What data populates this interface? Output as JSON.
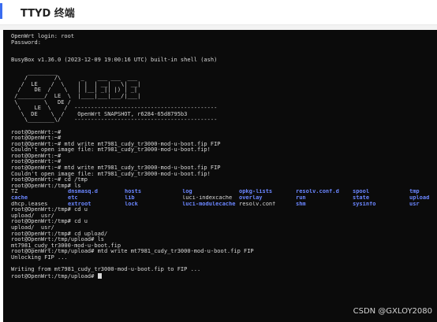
{
  "header": {
    "title": "TTYD 终端",
    "accent_color": "#3a6cf0"
  },
  "terminal": {
    "intro_lines": [
      "OpenWrt login: root",
      "Password:",
      "",
      "",
      "BusyBox v1.36.0 (2023-12-09 19:00:16 UTC) built-in shell (ash)",
      ""
    ],
    "ascii_lines": [
      "     _________",
      "    /        /\\      _    ___ ___  ___",
      "   /  LE    /  \\    | |  | __|   \\| __|",
      "  /    DE  /    \\   | |__| _|| |) | _|",
      " /________/  LE  \\  |____|___|___/|___|",
      " \\        \\   DE /",
      "  \\    LE  \\    /  -------------------------------------------",
      "   \\  DE    \\  /    OpenWrt SNAPSHOT, r6284-65d8795b3",
      "    \\________\\/    -------------------------------------------"
    ],
    "session_lines": [
      "",
      "root@OpenWrt:~#",
      "root@OpenWrt:~#",
      "root@OpenWrt:~# mtd write mt7981_cudy_tr3000-mod-u-boot.fip FIP",
      "Couldn't open image file: mt7981_cudy_tr3000-mod-u-boot.fip!",
      "root@OpenWrt:~#",
      "root@OpenWrt:~#",
      "root@OpenWrt:~# mtd write mt7981_cudy_tr3000-mod-u-boot.fip FIP",
      "Couldn't open image file: mt7981_cudy_tr3000-mod-u-boot.fip!",
      "root@OpenWrt:~# cd /tmp",
      "root@OpenWrt:/tmp# ls"
    ],
    "ls_rows": [
      [
        {
          "name": "TZ",
          "dir": false
        },
        {
          "name": "dnsmasq.d",
          "dir": true
        },
        {
          "name": "hosts",
          "dir": true
        },
        {
          "name": "log",
          "dir": true
        },
        {
          "name": "opkg-lists",
          "dir": true
        },
        {
          "name": "resolv.conf.d",
          "dir": true
        },
        {
          "name": "spool",
          "dir": true
        },
        {
          "name": "tmp",
          "dir": true
        }
      ],
      [
        {
          "name": "cache",
          "dir": true
        },
        {
          "name": "etc",
          "dir": true
        },
        {
          "name": "lib",
          "dir": true
        },
        {
          "name": "luci-indexcache",
          "dir": false
        },
        {
          "name": "overlay",
          "dir": true
        },
        {
          "name": "run",
          "dir": true
        },
        {
          "name": "state",
          "dir": true
        },
        {
          "name": "upload",
          "dir": true
        }
      ],
      [
        {
          "name": "dhcp.leases",
          "dir": false
        },
        {
          "name": "extroot",
          "dir": true
        },
        {
          "name": "lock",
          "dir": true
        },
        {
          "name": "luci-modulecache",
          "dir": true
        },
        {
          "name": "resolv.conf",
          "dir": false
        },
        {
          "name": "shm",
          "dir": true
        },
        {
          "name": "sysinfo",
          "dir": true
        },
        {
          "name": "usr",
          "dir": true
        }
      ]
    ],
    "after_lines": [
      "root@OpenWrt:/tmp# cd u",
      "upload/  usr/",
      "root@OpenWrt:/tmp# cd u",
      "upload/  usr/",
      "root@OpenWrt:/tmp# cd upload/",
      "root@OpenWrt:/tmp/upload# ls",
      "mt7981_cudy_tr3000-mod-u-boot.fip",
      "root@OpenWrt:/tmp/upload# mtd write mt7981_cudy_tr3000-mod-u-boot.fip FIP",
      "Unlocking FIP ...",
      "",
      "Writing from mt7981_cudy_tr3000-mod-u-boot.fip to FIP ..."
    ],
    "prompt_line": "root@OpenWrt:/tmp/upload# "
  },
  "watermark": "CSDN @GXLOY2080"
}
